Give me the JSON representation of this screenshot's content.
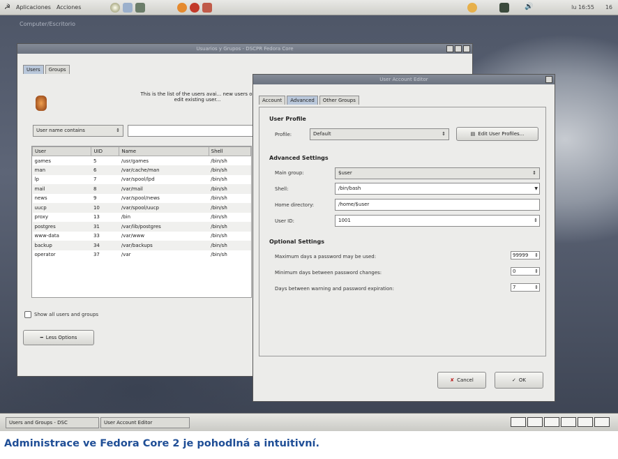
{
  "topbar": {
    "menu_apps": "Aplicaciones",
    "menu_actions": "Acciones",
    "clock": "lu 16:55",
    "tray": "16"
  },
  "desktop_label": "Computer/Escritorio",
  "main_window": {
    "title": "Usuarios y Grupos - DSCPR Fedora Core",
    "tabs": [
      "Users",
      "Groups"
    ],
    "intro": "This is the list of the users avai... new users or edit existing user...",
    "search_type": "User name contains",
    "columns": [
      "User",
      "UID",
      "Name",
      "Shell"
    ],
    "rows": [
      [
        "games",
        "5",
        "/usr/games",
        "/bin/sh"
      ],
      [
        "man",
        "6",
        "/var/cache/man",
        "/bin/sh"
      ],
      [
        "lp",
        "7",
        "/var/spool/lpd",
        "/bin/sh"
      ],
      [
        "mail",
        "8",
        "/var/mail",
        "/bin/sh"
      ],
      [
        "news",
        "9",
        "/var/spool/news",
        "/bin/sh"
      ],
      [
        "uucp",
        "10",
        "/var/spool/uucp",
        "/bin/sh"
      ],
      [
        "proxy",
        "13",
        "/bin",
        "/bin/sh"
      ],
      [
        "postgres",
        "31",
        "/var/lib/postgres",
        "/bin/sh"
      ],
      [
        "www-data",
        "33",
        "/var/www",
        "/bin/sh"
      ],
      [
        "backup",
        "34",
        "/var/backups",
        "/bin/sh"
      ],
      [
        "operator",
        "37",
        "/var",
        "/bin/sh"
      ]
    ],
    "show_all": "Show all users and groups",
    "less_options": "Less Options"
  },
  "editor": {
    "title": "User Account Editor",
    "tabs": [
      "Account",
      "Advanced",
      "Other Groups"
    ],
    "user_profile_header": "User Profile",
    "profile_label": "Profile:",
    "profile_value": "Default",
    "edit_profiles": "Edit User Profiles...",
    "advanced_header": "Advanced Settings",
    "main_group_label": "Main group:",
    "main_group_value": "$user",
    "shell_label": "Shell:",
    "shell_value": "/bin/bash",
    "home_label": "Home directory:",
    "home_value": "/home/$user",
    "uid_label": "User ID:",
    "uid_value": "1001",
    "optional_header": "Optional Settings",
    "max_days_label": "Maximum days a password may be used:",
    "max_days_value": "99999",
    "min_days_label": "Minimum days between password changes:",
    "min_days_value": "0",
    "warn_days_label": "Days between warning and password expiration:",
    "warn_days_value": "7",
    "cancel": "Cancel",
    "ok": "OK"
  },
  "taskbar": {
    "task1": "Users and Groups - DSC",
    "task2": "User Account Editor"
  },
  "caption": "Administrace ve Fedora Core 2 je pohodlná a intuitivní."
}
